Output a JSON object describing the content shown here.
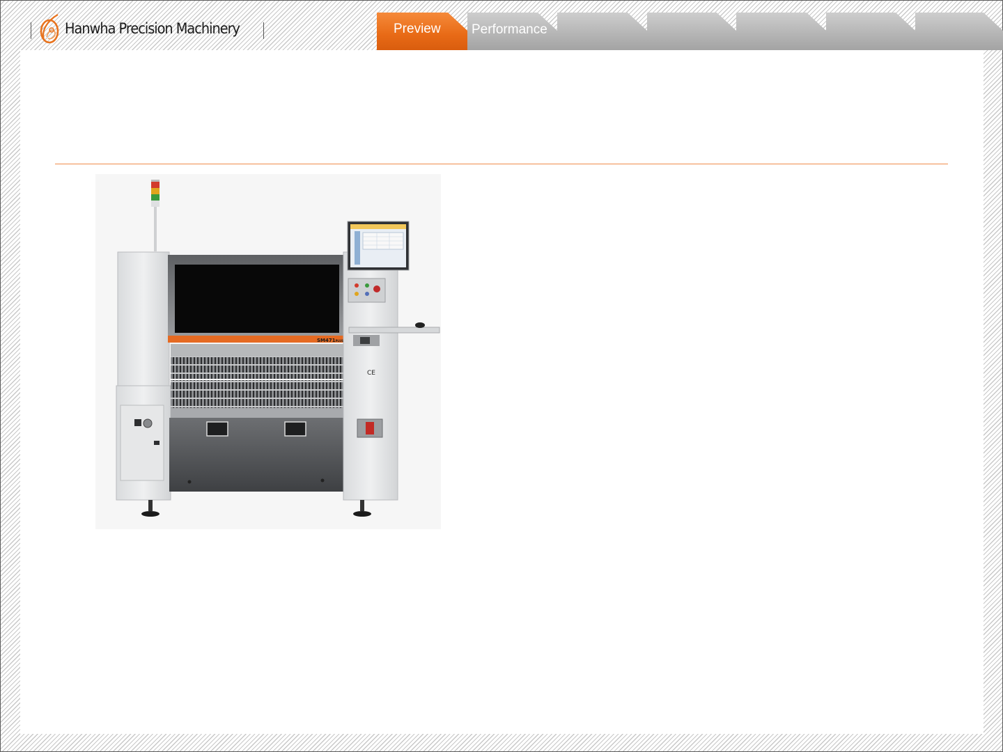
{
  "brand": {
    "name": "Hanwha Precision Machinery",
    "accent_color": "#e8731e",
    "logo_icon": "hanwha-flame-logo"
  },
  "tabs": [
    {
      "label": "Preview",
      "active": true
    },
    {
      "label": "Performance",
      "active": false
    },
    {
      "label": "",
      "active": false
    },
    {
      "label": "",
      "active": false
    },
    {
      "label": "",
      "active": false
    },
    {
      "label": "",
      "active": false
    },
    {
      "label": "",
      "active": false
    }
  ],
  "machine": {
    "model_label": "SM471",
    "model_suffix": "PLUS",
    "certification_mark": "CE"
  }
}
